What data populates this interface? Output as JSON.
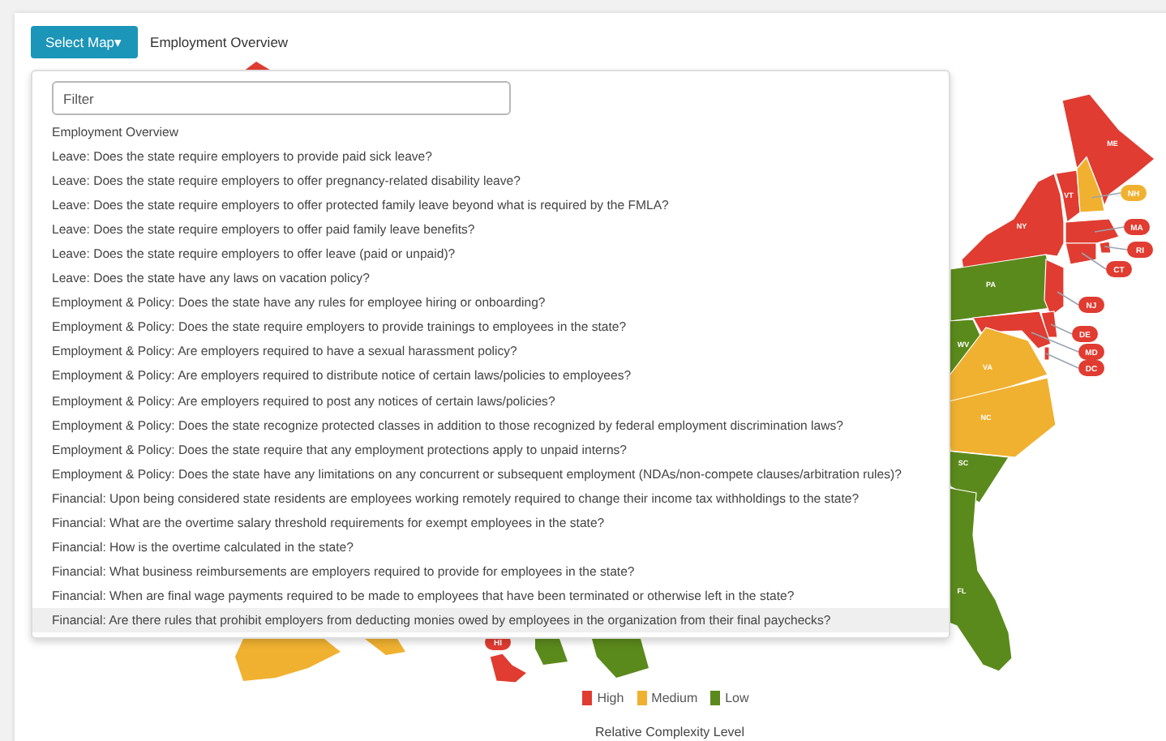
{
  "toolbar": {
    "button": "Select Map▾",
    "current_map": "Employment Overview"
  },
  "dropdown": {
    "filter": {
      "placeholder": "Filter"
    },
    "items": [
      {
        "label": "Employment Overview",
        "highlighted": false
      },
      {
        "label": "Leave: Does the state require employers to provide paid sick leave?",
        "highlighted": false
      },
      {
        "label": "Leave: Does the state require employers to offer pregnancy-related disability leave?",
        "highlighted": false
      },
      {
        "label": "Leave: Does the state require employers to offer protected family leave beyond what is required by the FMLA?",
        "highlighted": false
      },
      {
        "label": "Leave: Does the state require employers to offer paid family leave benefits?",
        "highlighted": false
      },
      {
        "label": "Leave: Does the state require employers to offer leave (paid or unpaid)?",
        "highlighted": false
      },
      {
        "label": "Leave: Does the state have any laws on vacation policy?",
        "highlighted": false
      },
      {
        "label": "Employment & Policy: Does the state have any rules for employee hiring or onboarding?",
        "highlighted": false
      },
      {
        "label": "Employment & Policy: Does the state require employers to provide trainings to employees in the state?",
        "highlighted": false
      },
      {
        "label": "Employment & Policy: Are employers required to have a sexual harassment policy?",
        "highlighted": false
      },
      {
        "label": "Employment & Policy: Are employers required to distribute notice of certain laws/policies to employees?",
        "highlighted": false
      },
      {
        "label": "Employment & Policy: Are employers required to post any notices of certain laws/policies?",
        "highlighted": false
      },
      {
        "label": "Employment & Policy: Does the state recognize protected classes in addition to those recognized by federal employment discrimination laws?",
        "highlighted": false
      },
      {
        "label": "Employment & Policy: Does the state require that any employment protections apply to unpaid interns?",
        "highlighted": false
      },
      {
        "label": "Employment & Policy: Does the state have any limitations on any concurrent or subsequent employment (NDAs/non-compete clauses/arbitration rules)?",
        "highlighted": false
      },
      {
        "label": "Financial: Upon being considered state residents are employees working remotely required to change their income tax withholdings to the state?",
        "highlighted": false
      },
      {
        "label": "Financial: What are the overtime salary threshold requirements for exempt employees in the state?",
        "highlighted": false
      },
      {
        "label": "Financial: How is the overtime calculated in the state?",
        "highlighted": false
      },
      {
        "label": "Financial: What business reimbursements are employers required to provide for employees in the state?",
        "highlighted": false
      },
      {
        "label": "Financial: When are final wage payments required to be made to employees that have been terminated or otherwise left in the state?",
        "highlighted": false
      },
      {
        "label": "Financial: Are there rules that prohibit employers from deducting monies owed by employees in the organization from their final paychecks?",
        "highlighted": true
      }
    ]
  },
  "map": {
    "states": [
      {
        "label": "ME",
        "kind": "inline",
        "color": "#e03c31"
      },
      {
        "label": "VT",
        "kind": "inline",
        "color": "#e03c31"
      },
      {
        "label": "NH",
        "kind": "callout",
        "color": "#f0b130"
      },
      {
        "label": "NY",
        "kind": "inline",
        "color": "#e03c31"
      },
      {
        "label": "MA",
        "kind": "callout",
        "color": "#e03c31"
      },
      {
        "label": "RI",
        "kind": "callout",
        "color": "#e03c31"
      },
      {
        "label": "CT",
        "kind": "callout",
        "color": "#e03c31"
      },
      {
        "label": "PA",
        "kind": "inline",
        "color": "#5b8a1c"
      },
      {
        "label": "NJ",
        "kind": "callout",
        "color": "#e03c31"
      },
      {
        "label": "DE",
        "kind": "callout",
        "color": "#e03c31"
      },
      {
        "label": "MD",
        "kind": "callout",
        "color": "#e03c31"
      },
      {
        "label": "DC",
        "kind": "callout",
        "color": "#e03c31"
      },
      {
        "label": "WV",
        "kind": "inline",
        "color": "#5b8a1c"
      },
      {
        "label": "VA",
        "kind": "inline",
        "color": "#f0b130"
      },
      {
        "label": "NC",
        "kind": "inline",
        "color": "#f0b130"
      },
      {
        "label": "SC",
        "kind": "inline",
        "color": "#5b8a1c"
      },
      {
        "label": "FL",
        "kind": "inline",
        "color": "#5b8a1c"
      },
      {
        "label": "HI",
        "kind": "callout",
        "color": "#e03c31"
      }
    ],
    "legend": {
      "items": [
        {
          "label": "High",
          "color": "#e03c31"
        },
        {
          "label": "Medium",
          "color": "#f0b130"
        },
        {
          "label": "Low",
          "color": "#5b8a1c"
        }
      ],
      "title": "Relative Complexity Level"
    }
  }
}
